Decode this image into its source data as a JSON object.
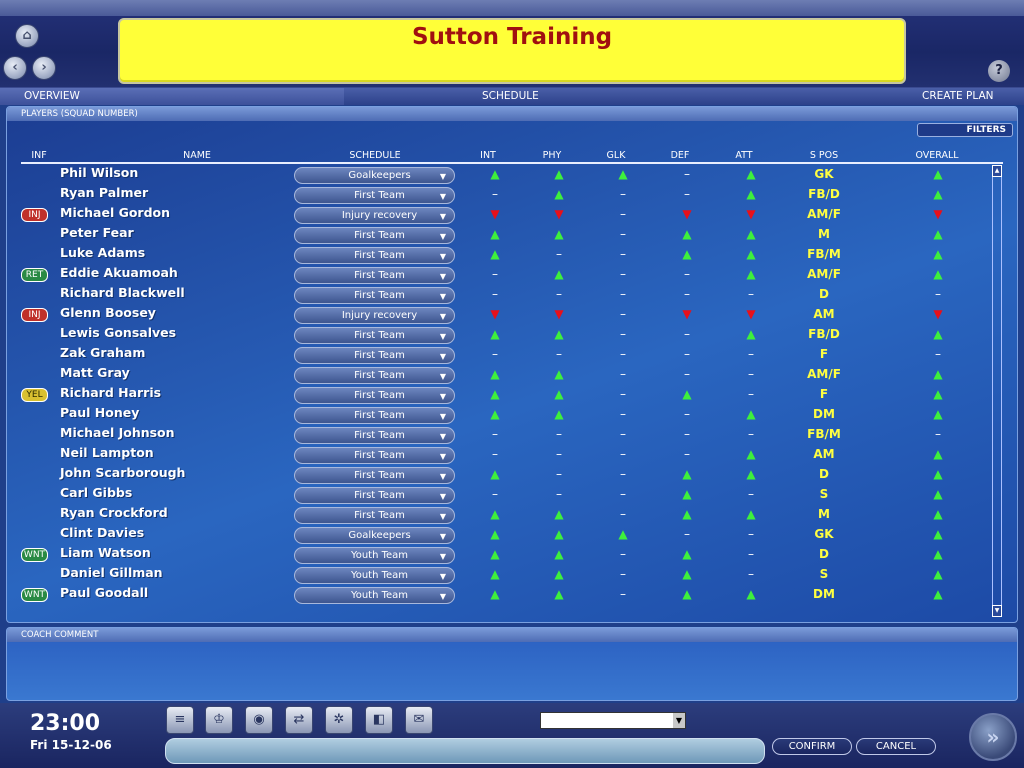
{
  "header": {
    "title": "Sutton Training",
    "help_icon": "?"
  },
  "tabs": [
    "OVERVIEW",
    "SCHEDULE",
    "CREATE PLAN"
  ],
  "panel": {
    "title": "PLAYERS (SQUAD NUMBER)",
    "filters_label": "FILTERS"
  },
  "columns": [
    "INF",
    "NAME",
    "SCHEDULE",
    "INT",
    "PHY",
    "GLK",
    "DEF",
    "ATT",
    "S POS",
    "OVERALL"
  ],
  "players": [
    {
      "inf": "",
      "name": "Phil Wilson",
      "schedule": "Goalkeepers",
      "int": "up",
      "phy": "up",
      "glk": "up",
      "def": "flat",
      "att": "up",
      "pos": "GK",
      "overall": "up"
    },
    {
      "inf": "",
      "name": "Ryan Palmer",
      "schedule": "First Team",
      "int": "flat",
      "phy": "up",
      "glk": "flat",
      "def": "flat",
      "att": "up",
      "pos": "FB/D",
      "overall": "up"
    },
    {
      "inf": "INJ",
      "name": "Michael Gordon",
      "schedule": "Injury recovery",
      "int": "down",
      "phy": "down",
      "glk": "flat",
      "def": "down",
      "att": "down",
      "pos": "AM/F",
      "overall": "down"
    },
    {
      "inf": "",
      "name": "Peter Fear",
      "schedule": "First Team",
      "int": "up",
      "phy": "up",
      "glk": "flat",
      "def": "up",
      "att": "up",
      "pos": "M",
      "overall": "up"
    },
    {
      "inf": "",
      "name": "Luke Adams",
      "schedule": "First Team",
      "int": "up",
      "phy": "flat",
      "glk": "flat",
      "def": "up",
      "att": "up",
      "pos": "FB/M",
      "overall": "up"
    },
    {
      "inf": "RET",
      "name": "Eddie Akuamoah",
      "schedule": "First Team",
      "int": "flat",
      "phy": "up",
      "glk": "flat",
      "def": "flat",
      "att": "up",
      "pos": "AM/F",
      "overall": "up"
    },
    {
      "inf": "",
      "name": "Richard Blackwell",
      "schedule": "First Team",
      "int": "flat",
      "phy": "flat",
      "glk": "flat",
      "def": "flat",
      "att": "flat",
      "pos": "D",
      "overall": "flat"
    },
    {
      "inf": "INJ",
      "name": "Glenn Boosey",
      "schedule": "Injury recovery",
      "int": "down",
      "phy": "down",
      "glk": "flat",
      "def": "down",
      "att": "down",
      "pos": "AM",
      "overall": "down"
    },
    {
      "inf": "",
      "name": "Lewis Gonsalves",
      "schedule": "First Team",
      "int": "up",
      "phy": "up",
      "glk": "flat",
      "def": "flat",
      "att": "up",
      "pos": "FB/D",
      "overall": "up"
    },
    {
      "inf": "",
      "name": "Zak Graham",
      "schedule": "First Team",
      "int": "flat",
      "phy": "flat",
      "glk": "flat",
      "def": "flat",
      "att": "flat",
      "pos": "F",
      "overall": "flat"
    },
    {
      "inf": "",
      "name": "Matt Gray",
      "schedule": "First Team",
      "int": "up",
      "phy": "up",
      "glk": "flat",
      "def": "flat",
      "att": "flat",
      "pos": "AM/F",
      "overall": "up"
    },
    {
      "inf": "YEL",
      "name": "Richard Harris",
      "schedule": "First Team",
      "int": "up",
      "phy": "up",
      "glk": "flat",
      "def": "up",
      "att": "flat",
      "pos": "F",
      "overall": "up"
    },
    {
      "inf": "",
      "name": "Paul Honey",
      "schedule": "First Team",
      "int": "up",
      "phy": "up",
      "glk": "flat",
      "def": "flat",
      "att": "up",
      "pos": "DM",
      "overall": "up"
    },
    {
      "inf": "",
      "name": "Michael Johnson",
      "schedule": "First Team",
      "int": "flat",
      "phy": "flat",
      "glk": "flat",
      "def": "flat",
      "att": "flat",
      "pos": "FB/M",
      "overall": "flat"
    },
    {
      "inf": "",
      "name": "Neil Lampton",
      "schedule": "First Team",
      "int": "flat",
      "phy": "flat",
      "glk": "flat",
      "def": "flat",
      "att": "up",
      "pos": "AM",
      "overall": "up"
    },
    {
      "inf": "",
      "name": "John Scarborough",
      "schedule": "First Team",
      "int": "up",
      "phy": "flat",
      "glk": "flat",
      "def": "up",
      "att": "up",
      "pos": "D",
      "overall": "up"
    },
    {
      "inf": "",
      "name": "Carl Gibbs",
      "schedule": "First Team",
      "int": "flat",
      "phy": "flat",
      "glk": "flat",
      "def": "up",
      "att": "flat",
      "pos": "S",
      "overall": "up"
    },
    {
      "inf": "",
      "name": "Ryan Crockford",
      "schedule": "First Team",
      "int": "up",
      "phy": "up",
      "glk": "flat",
      "def": "up",
      "att": "up",
      "pos": "M",
      "overall": "up"
    },
    {
      "inf": "",
      "name": "Clint Davies",
      "schedule": "Goalkeepers",
      "int": "up",
      "phy": "up",
      "glk": "up",
      "def": "flat",
      "att": "flat",
      "pos": "GK",
      "overall": "up"
    },
    {
      "inf": "WNT",
      "name": "Liam Watson",
      "schedule": "Youth Team",
      "int": "up",
      "phy": "up",
      "glk": "flat",
      "def": "up",
      "att": "flat",
      "pos": "D",
      "overall": "up"
    },
    {
      "inf": "",
      "name": "Daniel Gillman",
      "schedule": "Youth Team",
      "int": "up",
      "phy": "up",
      "glk": "flat",
      "def": "up",
      "att": "flat",
      "pos": "S",
      "overall": "up"
    },
    {
      "inf": "WNT",
      "name": "Paul Goodall",
      "schedule": "Youth Team",
      "int": "up",
      "phy": "up",
      "glk": "flat",
      "def": "up",
      "att": "up",
      "pos": "DM",
      "overall": "up"
    }
  ],
  "badge_colors": {
    "INJ": "#c0302a",
    "RET": "#2a8a44",
    "YEL": "#d8c030",
    "WNT": "#2a8a44"
  },
  "trend_glyphs": {
    "up": "▲",
    "down": "▼",
    "flat": "–"
  },
  "coach": {
    "title": "COACH COMMENT"
  },
  "footer": {
    "time": "23:00",
    "date": "Fri 15-12-06",
    "confirm_label": "CONFIRM",
    "cancel_label": "CANCEL",
    "combo_value": ""
  },
  "footer_icons": [
    "menu-icon",
    "trophy-icon",
    "globe-icon",
    "transfer-icon",
    "gear-icon",
    "fz-icon",
    "mail-icon"
  ]
}
